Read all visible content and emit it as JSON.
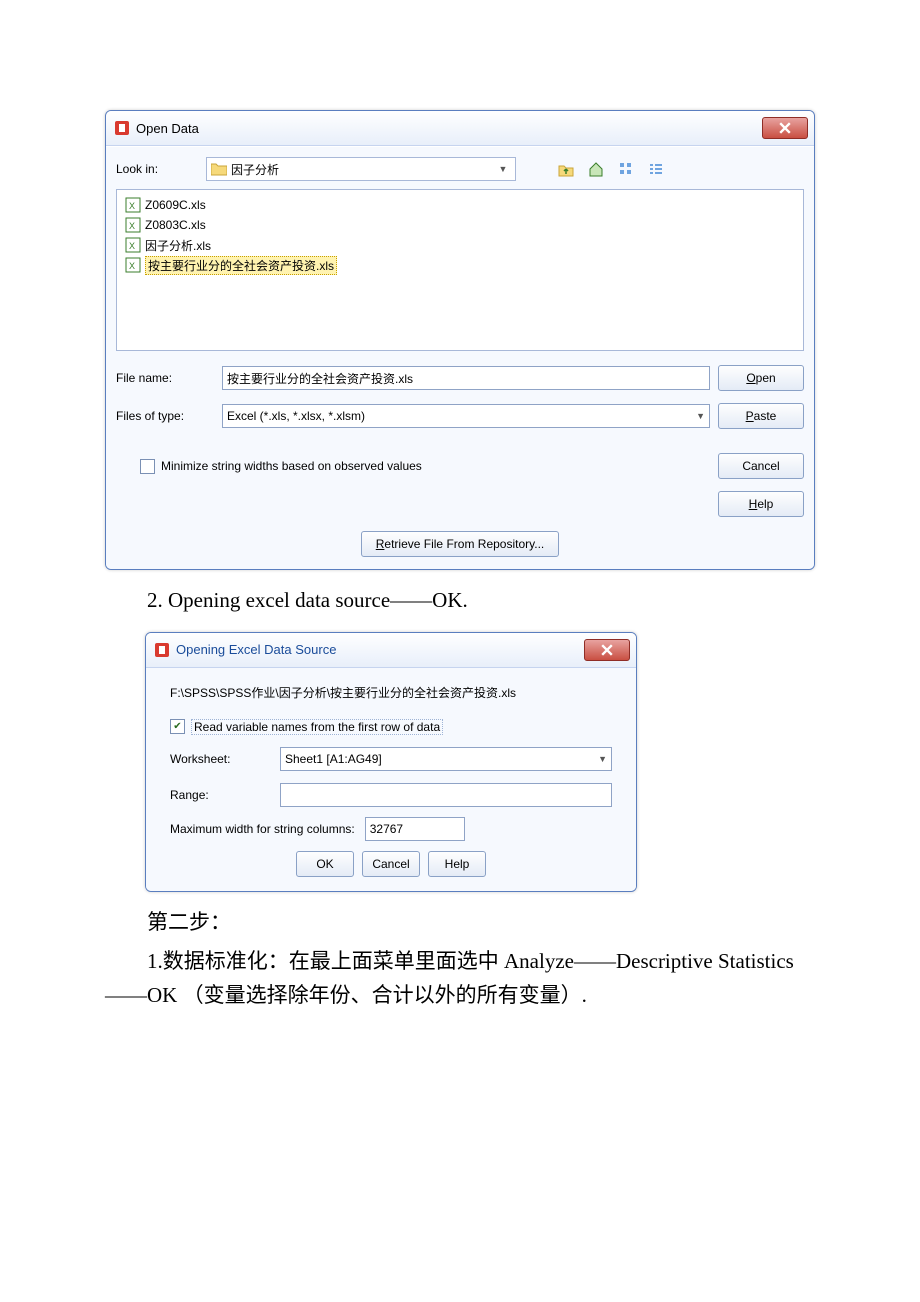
{
  "open_dialog": {
    "title": "Open Data",
    "look_in_label": "Look in:",
    "folder": "因子分析",
    "files": [
      {
        "name": "Z0609C.xls",
        "selected": false
      },
      {
        "name": "Z0803C.xls",
        "selected": false
      },
      {
        "name": "因子分析.xls",
        "selected": false
      },
      {
        "name": "按主要行业分的全社会资产投资.xls",
        "selected": true
      }
    ],
    "file_name_label": "File name:",
    "file_name_value": "按主要行业分的全社会资产投资.xls",
    "file_type_label": "Files of type:",
    "file_type_value": "Excel (*.xls, *.xlsx, *.xlsm)",
    "minimize_label": "Minimize string widths based on observed values",
    "minimize_checked": false,
    "retrieve_label": "Retrieve File From Repository...",
    "buttons": {
      "open": "Open",
      "paste": "Paste",
      "cancel": "Cancel",
      "help": "Help"
    }
  },
  "text_after_first": "2. Opening excel data source——OK.",
  "excel_dialog": {
    "title": "Opening Excel Data Source",
    "path": "F:\\SPSS\\SPSS作业\\因子分析\\按主要行业分的全社会资产投资.xls",
    "read_vars_label": "Read variable names from the first row of data",
    "read_vars_checked": true,
    "worksheet_label": "Worksheet:",
    "worksheet_value": "Sheet1 [A1:AG49]",
    "range_label": "Range:",
    "range_value": "",
    "maxwidth_label": "Maximum width for string columns:",
    "maxwidth_value": "32767",
    "buttons": {
      "ok": "OK",
      "cancel": "Cancel",
      "help": "Help"
    }
  },
  "step2_label": "第二步：",
  "step2_text": "1.数据标准化：在最上面菜单里面选中 Analyze——Descriptive Statistics——OK （变量选择除年份、合计以外的所有变量）."
}
